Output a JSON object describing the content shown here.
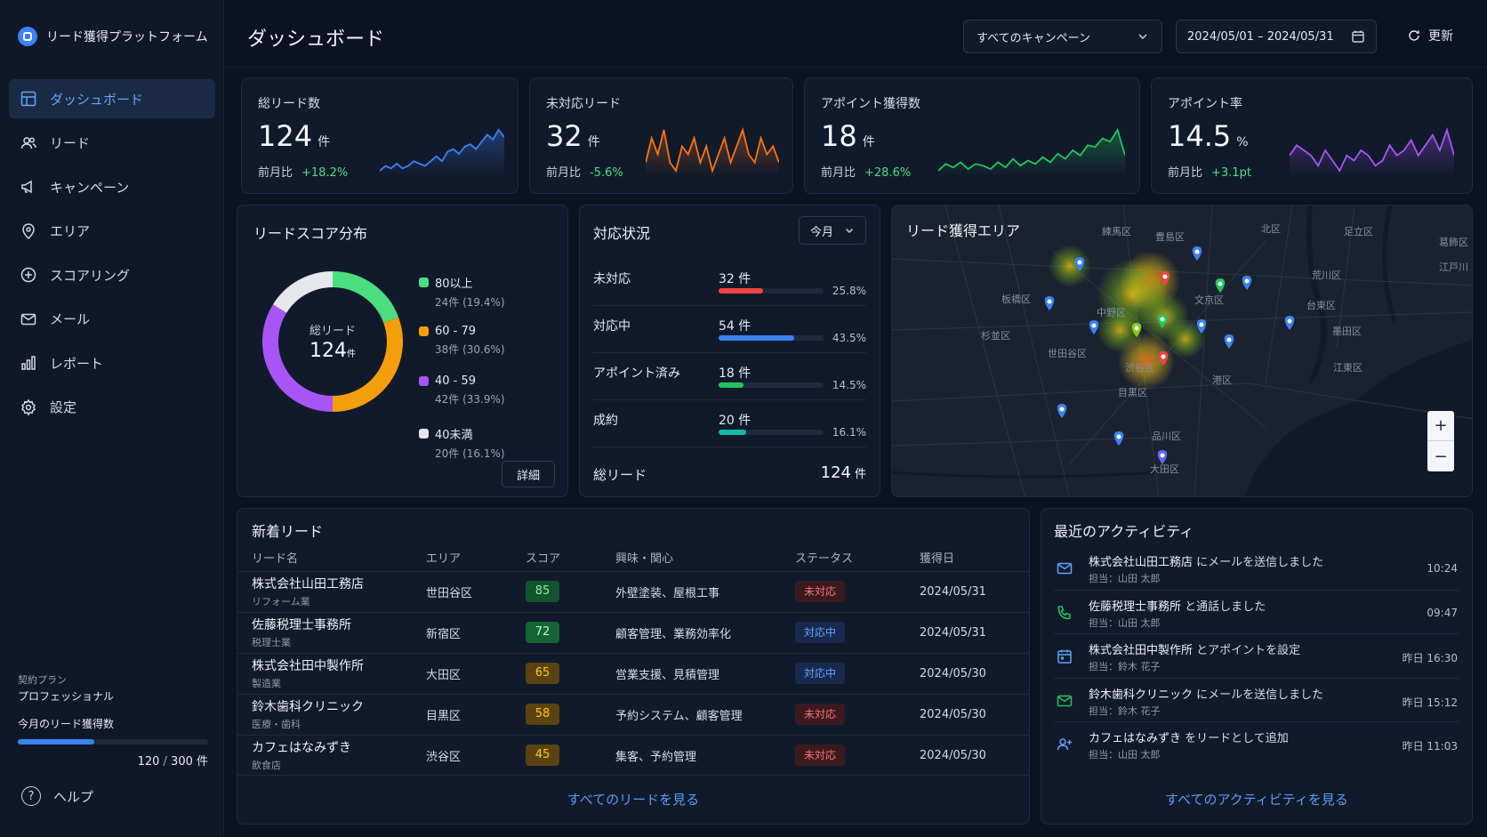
{
  "app": {
    "name": "リード獲得プラットフォーム"
  },
  "sidebar": {
    "items": [
      {
        "label": "ダッシュボード",
        "icon": "dashboard-icon",
        "active": true
      },
      {
        "label": "リード",
        "icon": "users-icon"
      },
      {
        "label": "キャンペーン",
        "icon": "megaphone-icon"
      },
      {
        "label": "エリア",
        "icon": "location-pin-icon"
      },
      {
        "label": "スコアリング",
        "icon": "plus-circle-icon"
      },
      {
        "label": "メール",
        "icon": "mail-icon"
      },
      {
        "label": "レポート",
        "icon": "bar-chart-icon"
      },
      {
        "label": "設定",
        "icon": "gear-icon"
      }
    ],
    "plan_label": "契約プラン",
    "plan_value": "プロフェッショナル",
    "quota_label": "今月のリード獲得数",
    "quota_current": "120",
    "quota_sep": " / ",
    "quota_max": "300 件",
    "quota_fraction": 0.4,
    "help_label": "ヘルプ",
    "help_glyph": "?"
  },
  "header": {
    "title": "ダッシュボード",
    "campaign_select": "すべてのキャンペーン",
    "date_range": "2024/05/01 – 2024/05/31",
    "refresh_label": "更新"
  },
  "kpis": [
    {
      "label": "総リード数",
      "value": "124",
      "unit": "件",
      "compare_label": "前月比",
      "change": "+18.2%",
      "color": "#3b82f6",
      "trend": [
        6,
        8,
        7,
        9,
        7,
        8,
        10,
        9,
        8,
        10,
        12,
        10,
        14,
        15,
        13,
        16,
        17,
        15,
        18,
        21,
        19,
        23,
        20
      ]
    },
    {
      "label": "未対応リード",
      "value": "32",
      "unit": "件",
      "compare_label": "前月比",
      "change": "-5.6%",
      "color": "#f97316",
      "trend": [
        12,
        15,
        13,
        16,
        12,
        11,
        14,
        13,
        15,
        12,
        14,
        11,
        13,
        15,
        12,
        14,
        16,
        13,
        12,
        15,
        13,
        14,
        12
      ]
    },
    {
      "label": "アポイント獲得数",
      "value": "18",
      "unit": "件",
      "compare_label": "前月比",
      "change": "+28.6%",
      "color": "#22c55e",
      "trend": [
        5,
        9,
        7,
        10,
        6,
        9,
        8,
        6,
        10,
        7,
        12,
        8,
        11,
        9,
        13,
        10,
        15,
        12,
        17,
        14,
        20,
        19,
        24,
        22,
        29,
        14
      ]
    },
    {
      "label": "アポイント率",
      "value": "14.5",
      "unit": "%",
      "compare_label": "前月比",
      "change": "+3.1pt",
      "color": "#a855f7",
      "trend": [
        12,
        14,
        13,
        12,
        10,
        13,
        11,
        9,
        12,
        11,
        13,
        12,
        10,
        11,
        14,
        12,
        13,
        15,
        12,
        14,
        16,
        13,
        17,
        12
      ]
    }
  ],
  "score_dist": {
    "title": "リードスコア分布",
    "center_label": "総リード",
    "center_value": "124",
    "center_unit": "件",
    "detail_label": "詳細"
  },
  "chart_data": {
    "type": "pie",
    "title": "リードスコア分布",
    "categories": [
      "80以上",
      "60 - 79",
      "40 - 59",
      "40未満"
    ],
    "values": [
      24,
      38,
      42,
      20
    ],
    "percent": [
      19.4,
      30.6,
      33.9,
      16.1
    ],
    "colors": [
      "#4ade80",
      "#f59e0b",
      "#a855f7",
      "#e5e7eb"
    ],
    "sublabels": [
      "24件 (19.4%)",
      "38件 (30.6%)",
      "42件 (33.9%)",
      "20件 (16.1%)"
    ],
    "total": 124
  },
  "status": {
    "title": "対応状況",
    "period": "今月",
    "rows": [
      {
        "label": "未対応",
        "count": "32 件",
        "pct": "25.8%",
        "fraction": 0.258,
        "color": "#ef4444"
      },
      {
        "label": "対応中",
        "count": "54 件",
        "pct": "43.5%",
        "fraction": 0.435,
        "color": "#3b82f6"
      },
      {
        "label": "アポイント済み",
        "count": "18 件",
        "pct": "14.5%",
        "fraction": 0.145,
        "color": "#22c55e"
      },
      {
        "label": "成約",
        "count": "20 件",
        "pct": "16.1%",
        "fraction": 0.161,
        "color": "#14b8a6"
      }
    ],
    "total_label": "総リード",
    "total_value": "124",
    "total_unit": "件"
  },
  "map": {
    "title": "リード獲得エリア",
    "zoom_in": "+",
    "zoom_out": "−",
    "districts": [
      "練馬区",
      "豊島区",
      "北区",
      "足立区",
      "葛飾区",
      "江戸川",
      "板橋区",
      "荒川区",
      "台東区",
      "杉並区",
      "中野区",
      "文京区",
      "墨田区",
      "江東区",
      "世田谷区",
      "渋谷区",
      "港区",
      "目黒区",
      "品川区",
      "大田区"
    ]
  },
  "leads": {
    "title": "新着リード",
    "columns": [
      "リード名",
      "エリア",
      "スコア",
      "興味・関心",
      "ステータス",
      "獲得日"
    ],
    "rows": [
      {
        "name": "株式会社山田工務店",
        "industry": "リフォーム業",
        "area": "世田谷区",
        "score": "85",
        "score_level": "high",
        "interest": "外壁塗装、屋根工事",
        "status": "未対応",
        "status_type": "pending",
        "date": "2024/05/31"
      },
      {
        "name": "佐藤税理士事務所",
        "industry": "税理士業",
        "area": "新宿区",
        "score": "72",
        "score_level": "mid",
        "interest": "顧客管理、業務効率化",
        "status": "対応中",
        "status_type": "active",
        "date": "2024/05/31"
      },
      {
        "name": "株式会社田中製作所",
        "industry": "製造業",
        "area": "大田区",
        "score": "65",
        "score_level": "low",
        "interest": "営業支援、見積管理",
        "status": "対応中",
        "status_type": "active",
        "date": "2024/05/30"
      },
      {
        "name": "鈴木歯科クリニック",
        "industry": "医療・歯科",
        "area": "目黒区",
        "score": "58",
        "score_level": "low",
        "interest": "予約システム、顧客管理",
        "status": "未対応",
        "status_type": "pending",
        "date": "2024/05/30"
      },
      {
        "name": "カフェはなみずき",
        "industry": "飲食店",
        "area": "渋谷区",
        "score": "45",
        "score_level": "low",
        "interest": "集客、予約管理",
        "status": "未対応",
        "status_type": "pending",
        "date": "2024/05/30"
      }
    ],
    "see_all": "すべてのリードを見る"
  },
  "activity": {
    "title": "最近のアクティビティ",
    "items": [
      {
        "icon": "mail-icon",
        "color": "#60a5fa",
        "subject": "株式会社山田工務店",
        "action": " にメールを送信しました",
        "owner": "担当：山田 太郎",
        "time": "10:24"
      },
      {
        "icon": "phone-icon",
        "color": "#22c55e",
        "subject": "佐藤税理士事務所",
        "action": " と通話しました",
        "owner": "担当：山田 太郎",
        "time": "09:47"
      },
      {
        "icon": "calendar-icon",
        "color": "#60a5fa",
        "subject": "株式会社田中製作所",
        "action": " とアポイントを設定",
        "owner": "担当：鈴木 花子",
        "time": "昨日 16:30"
      },
      {
        "icon": "mail-icon",
        "color": "#22c55e",
        "subject": "鈴木歯科クリニック",
        "action": " にメールを送信しました",
        "owner": "担当：鈴木 花子",
        "time": "昨日 15:12"
      },
      {
        "icon": "user-plus-icon",
        "color": "#60a5fa",
        "subject": "カフェはなみずき",
        "action": " をリードとして追加",
        "owner": "担当：山田 太郎",
        "time": "昨日 11:03"
      }
    ],
    "see_all": "すべてのアクティビティを見る"
  }
}
